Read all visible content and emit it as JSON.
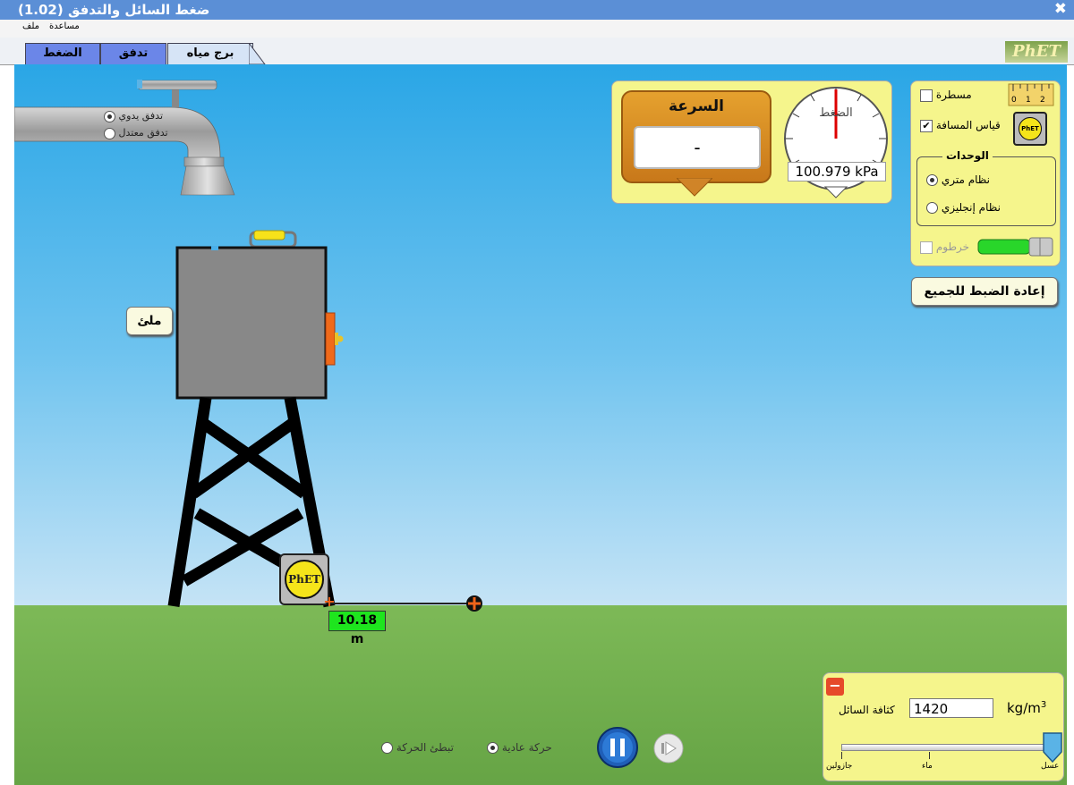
{
  "window": {
    "title": "(ضغط السائل والتدفق (1.02",
    "close_glyph": "✖"
  },
  "menu": {
    "file": "ملف",
    "help": "مساعدة"
  },
  "tabs": [
    {
      "label": "الضغط",
      "active": false
    },
    {
      "label": "تدفق",
      "active": false
    },
    {
      "label": "برج مياه",
      "active": true
    }
  ],
  "brand": "PhET",
  "faucet": {
    "manual_flow": "تدفق يدوي",
    "matched_flow": "تدفق معتدل",
    "selected": "manual"
  },
  "tank": {
    "fill_button": "ملئ"
  },
  "tape": {
    "badge": "PhET",
    "reading": "10.18 m"
  },
  "gauges": {
    "speed_label": "السرعة",
    "speed_value": "-",
    "pressure_label": "الضغط",
    "pressure_value": "100.979 kPa"
  },
  "controls": {
    "ruler": {
      "label": "مسطرة",
      "checked": false,
      "ticks": [
        "0",
        "1",
        "2"
      ]
    },
    "measuring_tape": {
      "label": "قياس المسافة",
      "checked": true,
      "badge": "PhET"
    },
    "units": {
      "title": "الوحدات",
      "metric": "نظام متري",
      "english": "نظام إنجليزي",
      "selected": "metric"
    },
    "hose": {
      "label": "خرطوم",
      "checked": false
    },
    "reset_all": "إعادة الضبط للجميع"
  },
  "playback": {
    "normal": "حركة عادية",
    "slow": "تبطئ الحركة",
    "selected": "normal"
  },
  "density": {
    "label": "كثافة السائل",
    "value": "1420",
    "unit": "kg/m",
    "unit_power": "3",
    "ticks": [
      "جازولين",
      "ماء",
      "عسل"
    ],
    "level_fraction": 1.0
  }
}
